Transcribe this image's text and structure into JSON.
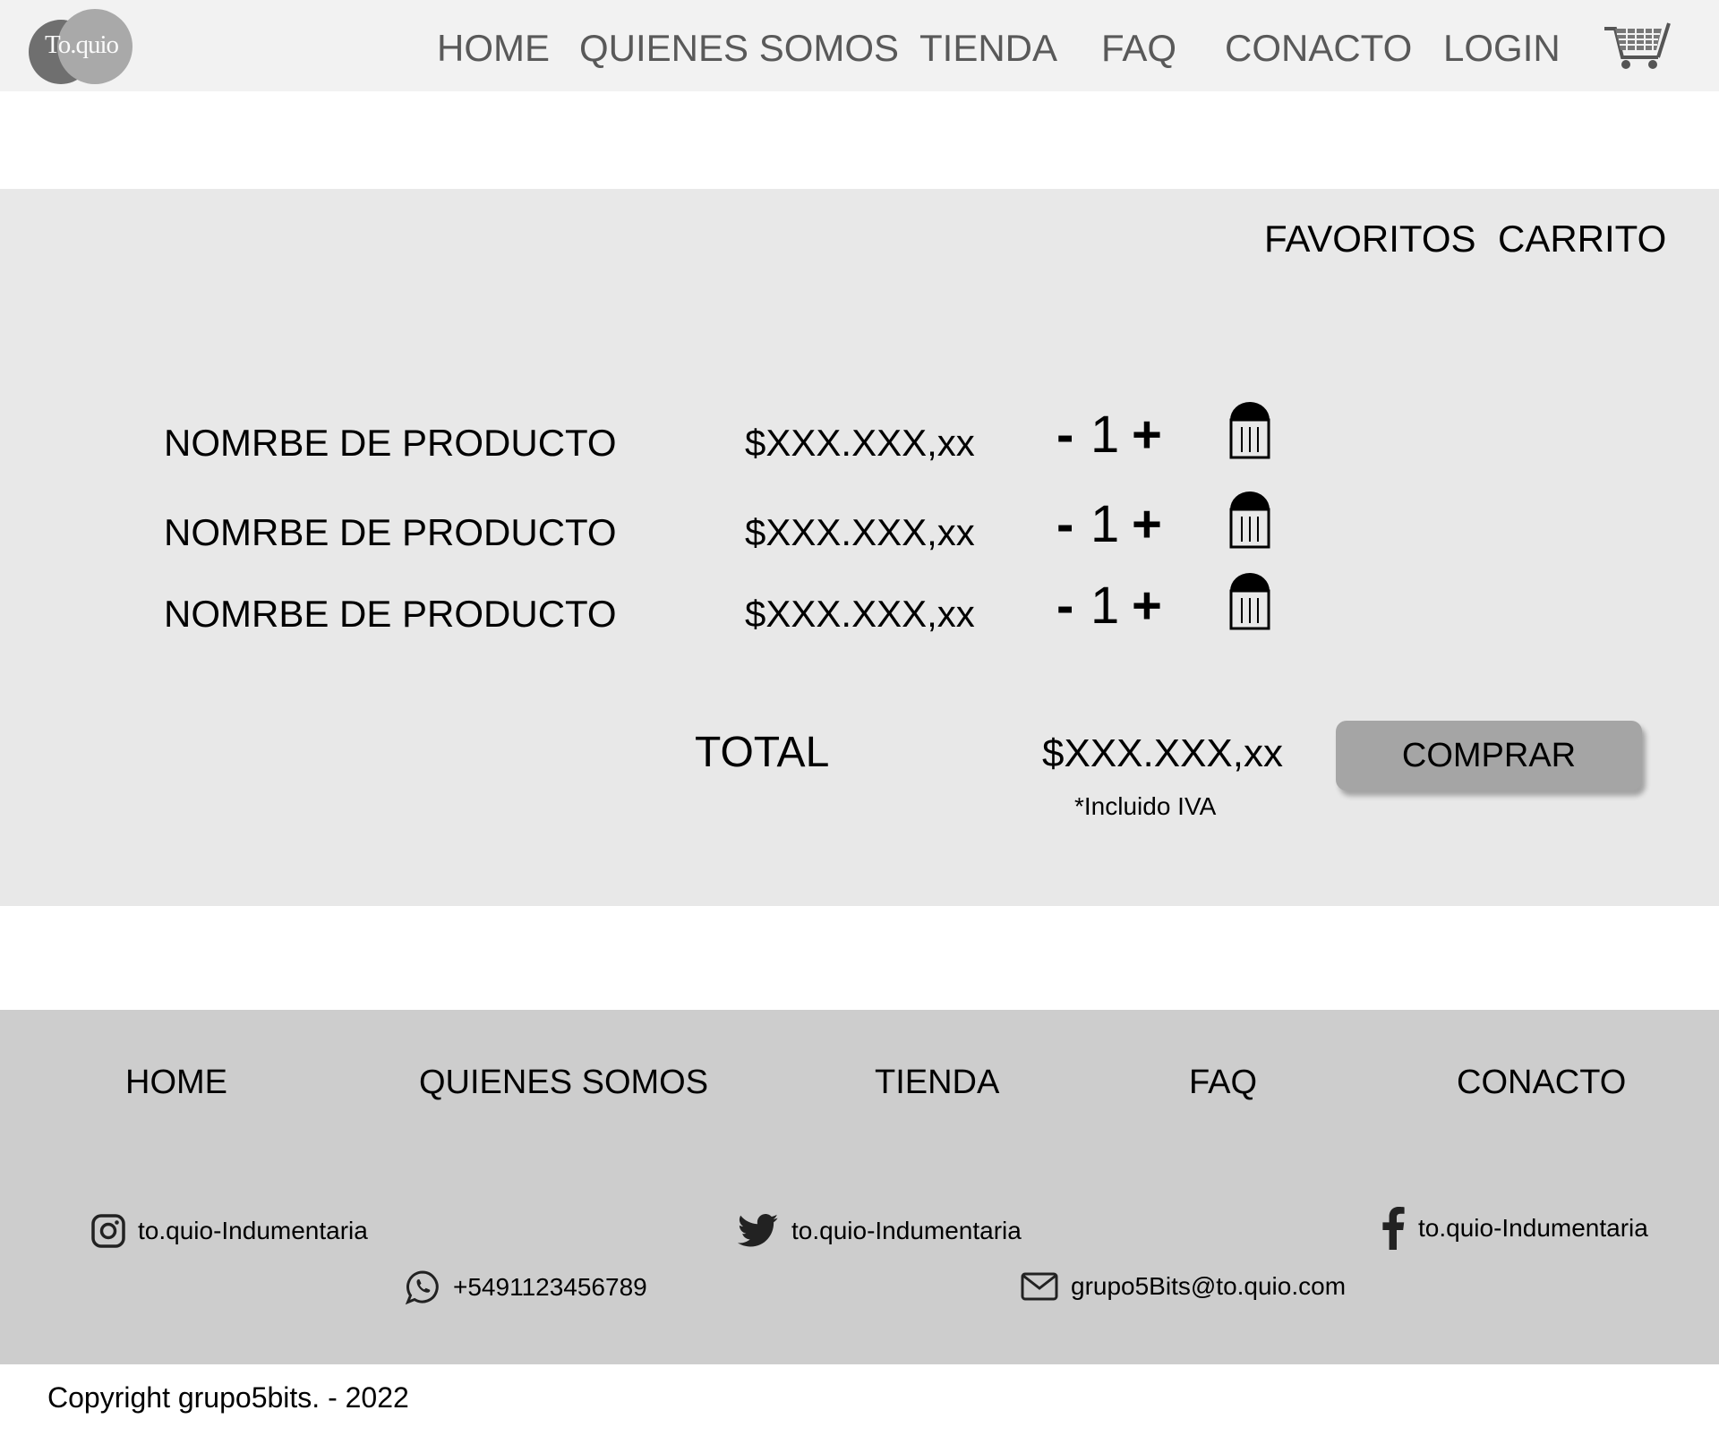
{
  "header": {
    "logo_text": "To.quio",
    "nav": [
      "HOME",
      "QUIENES SOMOS",
      "TIENDA",
      "FAQ",
      "CONACTO",
      "LOGIN"
    ],
    "cart_icon": "shopping-cart-icon"
  },
  "cart": {
    "tabs": [
      "FAVORITOS",
      "CARRITO"
    ],
    "items": [
      {
        "name": "NOMRBE DE PRODUCTO",
        "price": "$XXX.XXX,xx",
        "minus": "-",
        "qty": "1",
        "plus": "+",
        "icon": "trash-icon"
      },
      {
        "name": "NOMRBE DE PRODUCTO",
        "price": "$XXX.XXX,xx",
        "minus": "-",
        "qty": "1",
        "plus": "+",
        "icon": "trash-icon"
      },
      {
        "name": "NOMRBE DE PRODUCTO",
        "price": "$XXX.XXX,xx",
        "minus": "-",
        "qty": "1",
        "plus": "+",
        "icon": "trash-icon"
      }
    ],
    "total_label": "TOTAL",
    "total_value": "$XXX.XXX,xx",
    "iva_note": "*Incluido IVA",
    "buy_label": "COMPRAR"
  },
  "footer": {
    "nav": [
      "HOME",
      "QUIENES SOMOS",
      "TIENDA",
      "FAQ",
      "CONACTO"
    ],
    "instagram": "to.quio-Indumentaria",
    "twitter": "to.quio-Indumentaria",
    "facebook": "to.quio-Indumentaria",
    "whatsapp": "+5491123456789",
    "email": "grupo5Bits@to.quio.com"
  },
  "copyright": "Copyright grupo5bits. - 2022",
  "colors": {
    "header_bg": "#f2f2f2",
    "main_bg": "#e8e8e8",
    "footer_bg": "#cdcdcd",
    "button_bg": "#a5a5a5",
    "nav_text": "#595959"
  }
}
